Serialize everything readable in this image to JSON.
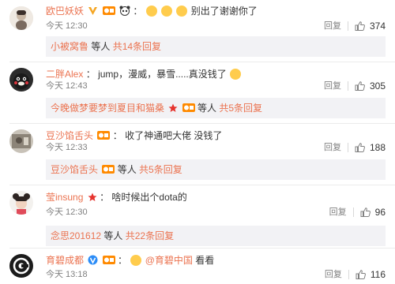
{
  "comments": [
    {
      "username": "欧巴妖妖",
      "separator": "：",
      "text": "别出了谢谢你了",
      "time": "今天 12:30",
      "reply_label": "回复",
      "likes": "374",
      "sub": {
        "who": "小被窝鲁",
        "more": " 等人 ",
        "count": "共14条回复"
      }
    },
    {
      "username": "二胖Alex",
      "separator": "：",
      "text": "jump，漫威，暴雪.....真没钱了",
      "time": "今天 12:43",
      "reply_label": "回复",
      "likes": "305",
      "sub": {
        "who": "今晚做梦要梦到夏目和猫桑",
        "more": " 等人 ",
        "count": "共5条回复"
      }
    },
    {
      "username": "豆沙馅舌头",
      "separator": "：",
      "text": "收了神通吧大佬 没钱了",
      "time": "今天 12:33",
      "reply_label": "回复",
      "likes": "188",
      "sub": {
        "who": "豆沙馅舌头",
        "more": " 等人 ",
        "count": "共5条回复"
      }
    },
    {
      "username": "莹insung",
      "separator": "：",
      "text": "啥时候出个dota的",
      "time": "今天 12:30",
      "reply_label": "回复",
      "likes": "96",
      "sub": {
        "who": "念思201612",
        "more": " 等人 ",
        "count": "共22条回复"
      }
    },
    {
      "username": "育碧成都",
      "separator": "：",
      "text_mention": "@育碧中国",
      "text": " 看看",
      "time": "今天 13:18",
      "reply_label": "回复",
      "likes": "116"
    }
  ],
  "colors": {
    "accent": "#eb7350",
    "subbox": "#f2f2f5",
    "muted": "#808080"
  }
}
